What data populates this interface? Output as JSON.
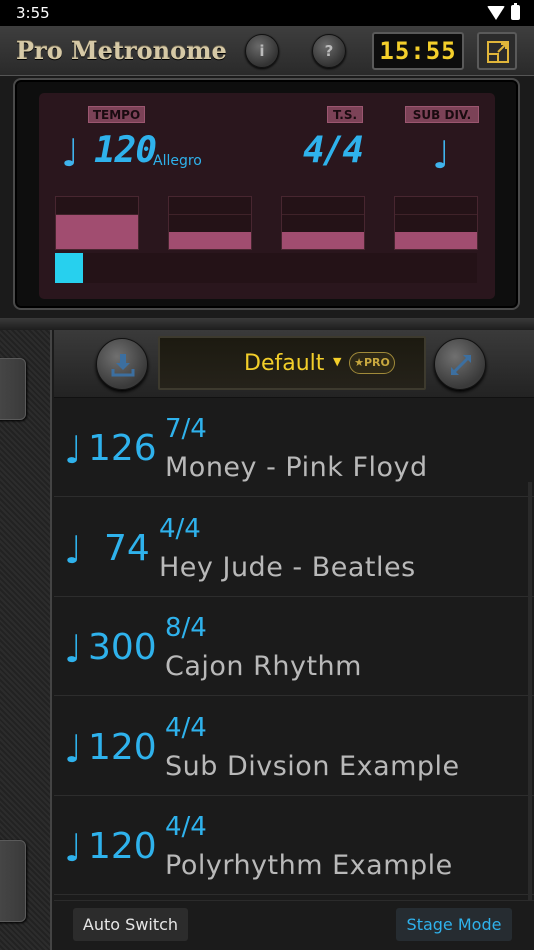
{
  "status": {
    "time": "3:55"
  },
  "header": {
    "title": "Pro Metronome",
    "info_label": "i",
    "help_label": "?",
    "clock": "15:55"
  },
  "lcd": {
    "tempo_label": "TEMPO",
    "ts_label": "T.S.",
    "subdiv_label": "SUB DIV.",
    "tempo_note": "♩",
    "tempo": "120",
    "tempo_marking": "Allegro",
    "time_signature": "4/4",
    "subdiv_note": "♩",
    "beats": [
      {
        "level": 0.66
      },
      {
        "level": 0.33
      },
      {
        "level": 0.33
      },
      {
        "level": 0.33
      }
    ],
    "progress": 0.066
  },
  "toolbar": {
    "preset": "Default",
    "preset_arrow": "▼",
    "pro_badge": "★PRO"
  },
  "presets": [
    {
      "note": "♩",
      "bpm": "126",
      "ts": "7/4",
      "name": "Money - Pink Floyd"
    },
    {
      "note": "♩",
      "bpm": "74",
      "ts": "4/4",
      "name": "Hey Jude - Beatles"
    },
    {
      "note": "♩",
      "bpm": "300",
      "ts": "8/4",
      "name": "Cajon Rhythm"
    },
    {
      "note": "♩",
      "bpm": "120",
      "ts": "4/4",
      "name": "Sub Divsion Example"
    },
    {
      "note": "♩",
      "bpm": "120",
      "ts": "4/4",
      "name": "Polyrhythm Example"
    }
  ],
  "bottom": {
    "auto_switch": "Auto Switch",
    "stage_mode": "Stage Mode"
  },
  "colors": {
    "accent_blue": "#2fb2ec",
    "accent_yellow": "#f3cf2a",
    "beat_fill": "#a14d70",
    "progress_fill": "#27d0ee"
  }
}
